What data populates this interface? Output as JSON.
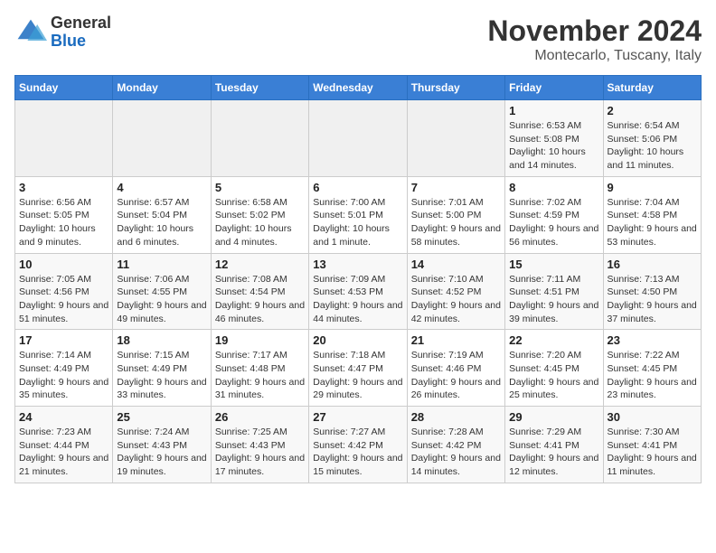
{
  "header": {
    "logo": {
      "general": "General",
      "blue": "Blue"
    },
    "title": "November 2024",
    "location": "Montecarlo, Tuscany, Italy"
  },
  "calendar": {
    "days_of_week": [
      "Sunday",
      "Monday",
      "Tuesday",
      "Wednesday",
      "Thursday",
      "Friday",
      "Saturday"
    ],
    "weeks": [
      [
        {
          "day": "",
          "info": ""
        },
        {
          "day": "",
          "info": ""
        },
        {
          "day": "",
          "info": ""
        },
        {
          "day": "",
          "info": ""
        },
        {
          "day": "",
          "info": ""
        },
        {
          "day": "1",
          "info": "Sunrise: 6:53 AM\nSunset: 5:08 PM\nDaylight: 10 hours and 14 minutes."
        },
        {
          "day": "2",
          "info": "Sunrise: 6:54 AM\nSunset: 5:06 PM\nDaylight: 10 hours and 11 minutes."
        }
      ],
      [
        {
          "day": "3",
          "info": "Sunrise: 6:56 AM\nSunset: 5:05 PM\nDaylight: 10 hours and 9 minutes."
        },
        {
          "day": "4",
          "info": "Sunrise: 6:57 AM\nSunset: 5:04 PM\nDaylight: 10 hours and 6 minutes."
        },
        {
          "day": "5",
          "info": "Sunrise: 6:58 AM\nSunset: 5:02 PM\nDaylight: 10 hours and 4 minutes."
        },
        {
          "day": "6",
          "info": "Sunrise: 7:00 AM\nSunset: 5:01 PM\nDaylight: 10 hours and 1 minute."
        },
        {
          "day": "7",
          "info": "Sunrise: 7:01 AM\nSunset: 5:00 PM\nDaylight: 9 hours and 58 minutes."
        },
        {
          "day": "8",
          "info": "Sunrise: 7:02 AM\nSunset: 4:59 PM\nDaylight: 9 hours and 56 minutes."
        },
        {
          "day": "9",
          "info": "Sunrise: 7:04 AM\nSunset: 4:58 PM\nDaylight: 9 hours and 53 minutes."
        }
      ],
      [
        {
          "day": "10",
          "info": "Sunrise: 7:05 AM\nSunset: 4:56 PM\nDaylight: 9 hours and 51 minutes."
        },
        {
          "day": "11",
          "info": "Sunrise: 7:06 AM\nSunset: 4:55 PM\nDaylight: 9 hours and 49 minutes."
        },
        {
          "day": "12",
          "info": "Sunrise: 7:08 AM\nSunset: 4:54 PM\nDaylight: 9 hours and 46 minutes."
        },
        {
          "day": "13",
          "info": "Sunrise: 7:09 AM\nSunset: 4:53 PM\nDaylight: 9 hours and 44 minutes."
        },
        {
          "day": "14",
          "info": "Sunrise: 7:10 AM\nSunset: 4:52 PM\nDaylight: 9 hours and 42 minutes."
        },
        {
          "day": "15",
          "info": "Sunrise: 7:11 AM\nSunset: 4:51 PM\nDaylight: 9 hours and 39 minutes."
        },
        {
          "day": "16",
          "info": "Sunrise: 7:13 AM\nSunset: 4:50 PM\nDaylight: 9 hours and 37 minutes."
        }
      ],
      [
        {
          "day": "17",
          "info": "Sunrise: 7:14 AM\nSunset: 4:49 PM\nDaylight: 9 hours and 35 minutes."
        },
        {
          "day": "18",
          "info": "Sunrise: 7:15 AM\nSunset: 4:49 PM\nDaylight: 9 hours and 33 minutes."
        },
        {
          "day": "19",
          "info": "Sunrise: 7:17 AM\nSunset: 4:48 PM\nDaylight: 9 hours and 31 minutes."
        },
        {
          "day": "20",
          "info": "Sunrise: 7:18 AM\nSunset: 4:47 PM\nDaylight: 9 hours and 29 minutes."
        },
        {
          "day": "21",
          "info": "Sunrise: 7:19 AM\nSunset: 4:46 PM\nDaylight: 9 hours and 26 minutes."
        },
        {
          "day": "22",
          "info": "Sunrise: 7:20 AM\nSunset: 4:45 PM\nDaylight: 9 hours and 25 minutes."
        },
        {
          "day": "23",
          "info": "Sunrise: 7:22 AM\nSunset: 4:45 PM\nDaylight: 9 hours and 23 minutes."
        }
      ],
      [
        {
          "day": "24",
          "info": "Sunrise: 7:23 AM\nSunset: 4:44 PM\nDaylight: 9 hours and 21 minutes."
        },
        {
          "day": "25",
          "info": "Sunrise: 7:24 AM\nSunset: 4:43 PM\nDaylight: 9 hours and 19 minutes."
        },
        {
          "day": "26",
          "info": "Sunrise: 7:25 AM\nSunset: 4:43 PM\nDaylight: 9 hours and 17 minutes."
        },
        {
          "day": "27",
          "info": "Sunrise: 7:27 AM\nSunset: 4:42 PM\nDaylight: 9 hours and 15 minutes."
        },
        {
          "day": "28",
          "info": "Sunrise: 7:28 AM\nSunset: 4:42 PM\nDaylight: 9 hours and 14 minutes."
        },
        {
          "day": "29",
          "info": "Sunrise: 7:29 AM\nSunset: 4:41 PM\nDaylight: 9 hours and 12 minutes."
        },
        {
          "day": "30",
          "info": "Sunrise: 7:30 AM\nSunset: 4:41 PM\nDaylight: 9 hours and 11 minutes."
        }
      ]
    ]
  }
}
